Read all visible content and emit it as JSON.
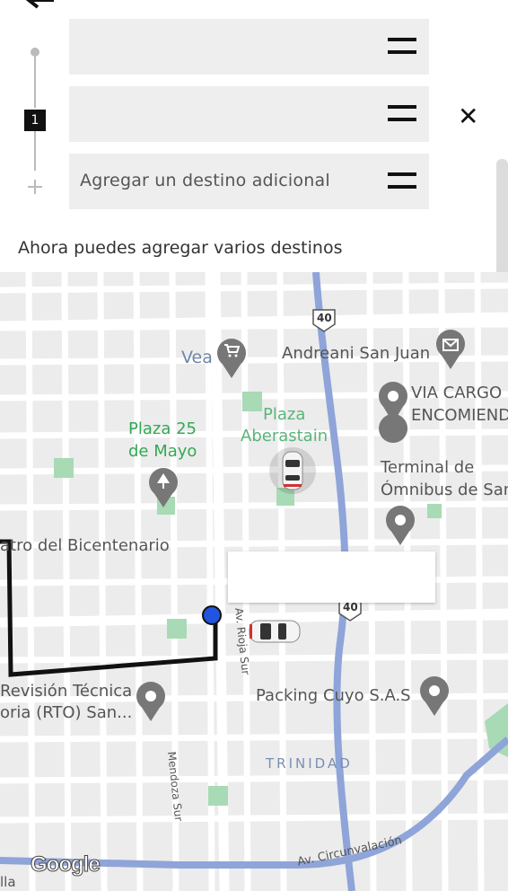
{
  "header": {
    "stop_number": "1",
    "fields": [
      {
        "value": "",
        "placeholder": ""
      },
      {
        "value": "",
        "placeholder": ""
      },
      {
        "value": "",
        "placeholder": "Agregar un destino adicional"
      }
    ],
    "hint": "Ahora puedes agregar varios destinos",
    "close_symbol": "✕"
  },
  "map": {
    "labels": {
      "vea": "Vea",
      "andreani": "Andreani San Juan",
      "via_cargo_1": "VIA CARGO",
      "via_cargo_2": "ENCOMIEND",
      "plaza25_1": "Plaza 25",
      "plaza25_2": "de Mayo",
      "plaza_ab_1": "Plaza",
      "plaza_ab_2": "Aberastain",
      "terminal_1": "Terminal de",
      "terminal_2": "Ómnibus de San",
      "teatro": "atro del Bicentenario",
      "revision_1": "Revisión Técnica",
      "revision_2": "oria (RTO) San...",
      "packing": "Packing Cuyo S.A.S",
      "trinidad": "TRINIDAD",
      "mendoza": "Mendoza Sur",
      "rioja": "Av. Rioja Sur",
      "circunvalacion": "Av. Circunvalación",
      "route_40_a": "40",
      "route_40_b": "40",
      "google": "Google",
      "bottom_left": "lla"
    },
    "colors": {
      "route": "#111111",
      "highway": "#8fa4d8",
      "park": "#a8dab5",
      "poi_green": "#34a853",
      "pickup_dot": "#2255dd"
    }
  }
}
